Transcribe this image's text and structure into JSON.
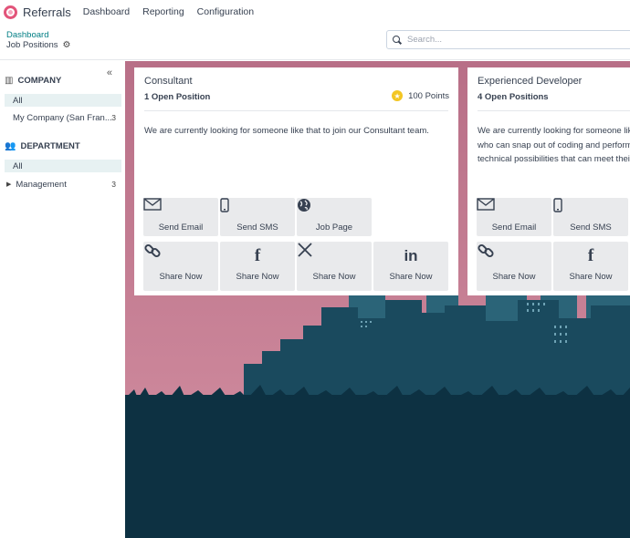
{
  "app": {
    "name": "Referrals"
  },
  "nav": [
    "Dashboard",
    "Reporting",
    "Configuration"
  ],
  "breadcrumb": {
    "parent": "Dashboard",
    "current": "Job Positions"
  },
  "search": {
    "placeholder": "Search..."
  },
  "sidebar": {
    "collapse": "«",
    "company": {
      "title": "COMPANY",
      "items": [
        {
          "label": "All",
          "count": ""
        },
        {
          "label": "My Company (San Fran...",
          "count": "3"
        }
      ]
    },
    "department": {
      "title": "DEPARTMENT",
      "items": [
        {
          "label": "All",
          "count": ""
        },
        {
          "label": "Management",
          "count": "3"
        }
      ]
    }
  },
  "cards": [
    {
      "title": "Consultant",
      "open_positions": "1 Open Position",
      "points": "100 Points",
      "description": [
        "We are currently looking for someone like that to join our Consultant team."
      ],
      "actions": [
        "Send Email",
        "Send SMS",
        "Job Page"
      ],
      "shares": [
        "Share Now",
        "Share Now",
        "Share Now",
        "Share Now"
      ]
    },
    {
      "title": "Experienced Developer",
      "open_positions": "4 Open Positions",
      "description": [
        "We are currently looking for someone like",
        "who can snap out of coding and perform",
        "technical possibilities that can meet their"
      ],
      "actions": [
        "Send Email",
        "Send SMS"
      ],
      "shares": [
        "Share Now",
        "Share Now"
      ]
    }
  ],
  "colors": {
    "accent": "#017e84",
    "sky": "#c77f94",
    "city": "#1a4a5e",
    "ground": "#0d3142"
  }
}
